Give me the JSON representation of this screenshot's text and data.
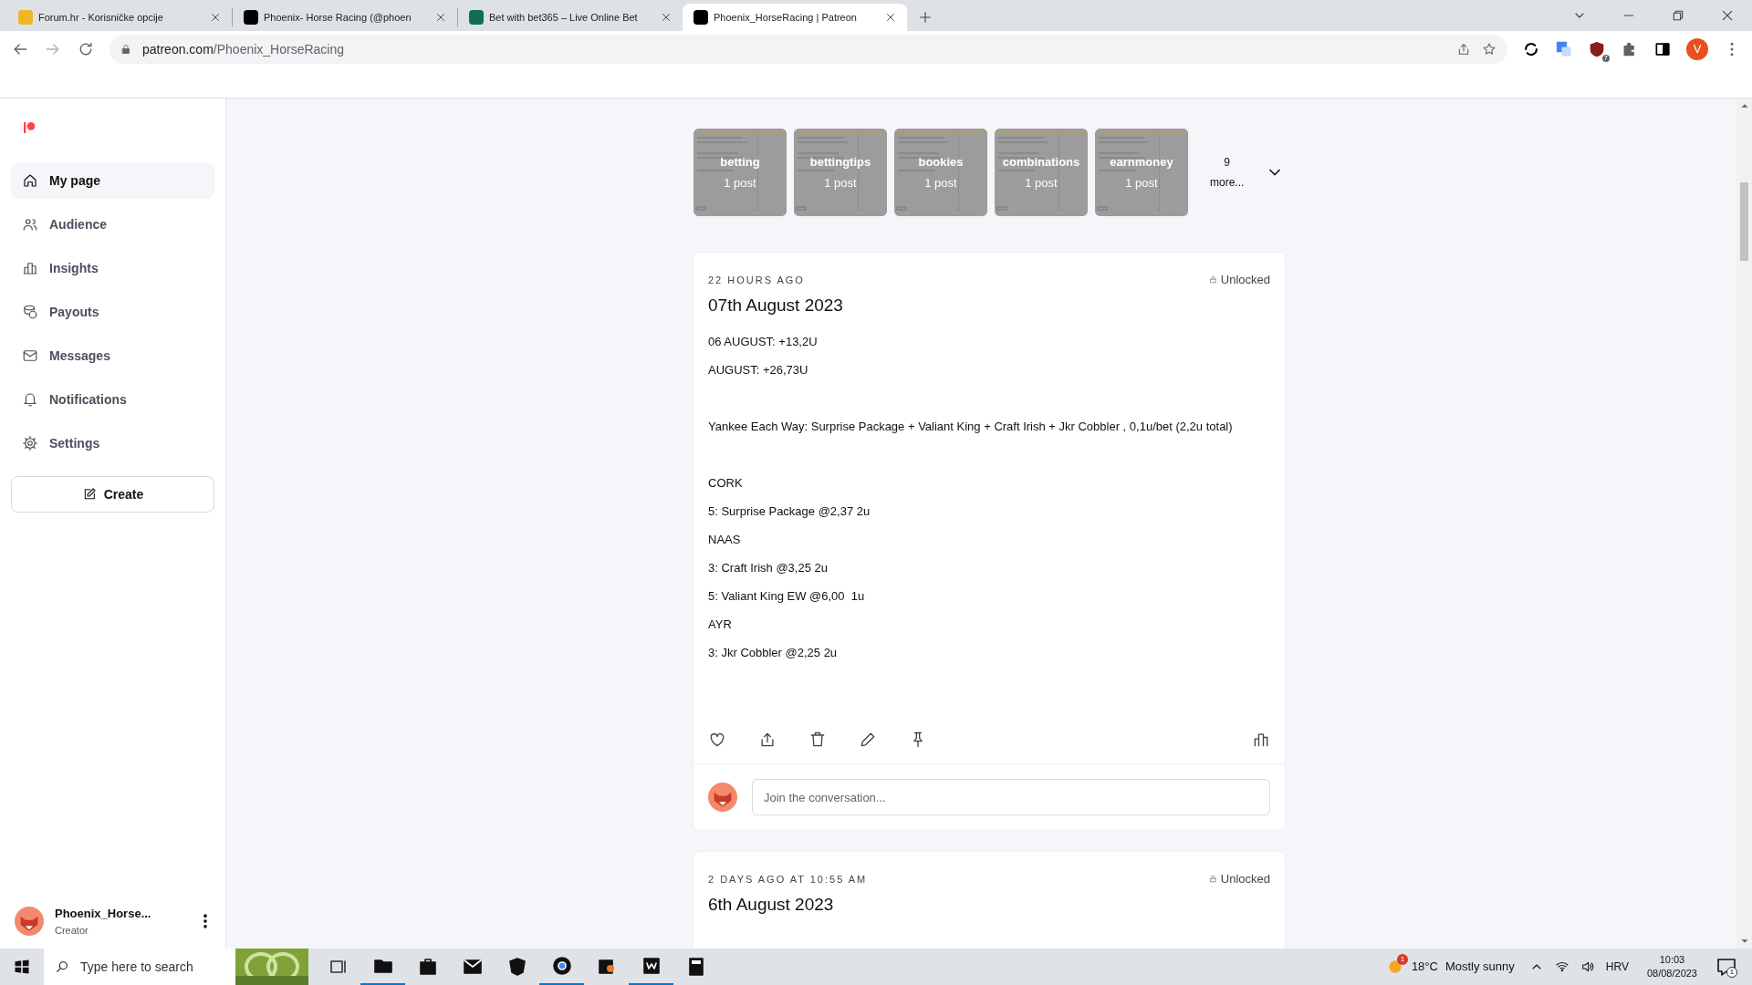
{
  "browser": {
    "tabs": [
      {
        "title": "Forum.hr - Korisničke opcije",
        "selected": false
      },
      {
        "title": "Phoenix- Horse Racing (@phoen",
        "selected": false
      },
      {
        "title": "Bet with bet365 – Live Online Bet",
        "selected": false
      },
      {
        "title": "Phoenix_HorseRacing | Patreon",
        "selected": true
      }
    ],
    "url_host": "patreon.com",
    "url_path": "/Phoenix_HorseRacing",
    "extension_badge": "7",
    "profile_letter": "V"
  },
  "sidebar": {
    "items": [
      {
        "label": "My page",
        "selected": true
      },
      {
        "label": "Audience",
        "selected": false
      },
      {
        "label": "Insights",
        "selected": false
      },
      {
        "label": "Payouts",
        "selected": false
      },
      {
        "label": "Messages",
        "selected": false
      },
      {
        "label": "Notifications",
        "selected": false
      },
      {
        "label": "Settings",
        "selected": false
      }
    ],
    "create": "Create",
    "user": {
      "name": "Phoenix_Horse...",
      "role": "Creator"
    }
  },
  "tags": [
    {
      "name": "betting",
      "count": "1 post"
    },
    {
      "name": "bettingtips",
      "count": "1 post"
    },
    {
      "name": "bookies",
      "count": "1 post"
    },
    {
      "name": "combinations",
      "count": "1 post"
    },
    {
      "name": "earnmoney",
      "count": "1 post"
    }
  ],
  "more_tags": {
    "count": "9",
    "label": "more..."
  },
  "posts": [
    {
      "time": "22 HOURS AGO",
      "access": "Unlocked",
      "title": "07th August 2023",
      "blocks": [
        [
          "06 AUGUST: +13,2U",
          "AUGUST: +26,73U"
        ],
        [
          "Yankee Each Way: Surprise Package + Valiant King + Craft Irish + Jkr Cobbler , 0,1u/bet (2,2u total)"
        ],
        [
          "CORK",
          "5: Surprise Package @2,37 2u",
          "NAAS",
          "3: Craft Irish @3,25 2u",
          "5: Valiant King EW @6,00  1u",
          "AYR",
          "3: Jkr Cobbler @2,25 2u"
        ]
      ],
      "comment_placeholder": "Join the conversation..."
    },
    {
      "time": "2 DAYS AGO AT 10:55 AM",
      "access": "Unlocked",
      "title": "6th August 2023"
    }
  ],
  "taskbar": {
    "search_placeholder": "Type here to search",
    "weather_badge": "1",
    "temperature": "18°C",
    "weather": "Mostly sunny",
    "language": "HRV",
    "time": "10:03",
    "date": "08/08/2023",
    "notification_count": "1"
  }
}
